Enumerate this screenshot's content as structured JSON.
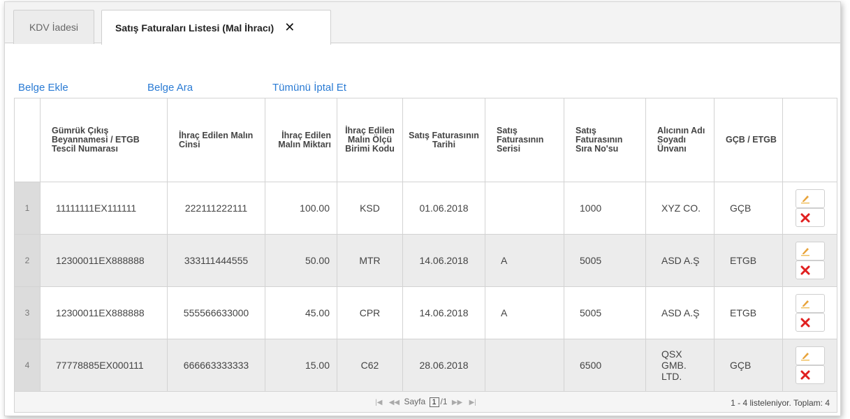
{
  "tabs": [
    {
      "label": "KDV İadesi"
    },
    {
      "label": "Satış Faturaları Listesi (Mal İhracı)",
      "close": "✕"
    }
  ],
  "actions": {
    "add": "Belge Ekle",
    "search": "Belge Ara",
    "cancel_all": "Tümünü İptal Et"
  },
  "table": {
    "headers": [
      "Gümrük Çıkış Beyannamesi / ETGB Tescil Numarası",
      "İhraç Edilen Malın Cinsi",
      "İhraç Edilen Malın Miktarı",
      "İhraç Edilen Malın Ölçü Birimi Kodu",
      "Satış Faturasının Tarihi",
      "Satış Faturasının Serisi",
      "Satış Faturasının Sıra No'su",
      "Alıcının Adı Soyadı Ünvanı",
      "GÇB / ETGB"
    ],
    "rows": [
      {
        "n": "1",
        "gcb": "11111111EX111111",
        "cins": "222111222111",
        "miktar": "100.00",
        "birim": "KSD",
        "tarih": "01.06.2018",
        "seri": "",
        "sira": "1000",
        "alici": "XYZ CO.",
        "tip": "GÇB"
      },
      {
        "n": "2",
        "gcb": "12300011EX888888",
        "cins": "333111444555",
        "miktar": "50.00",
        "birim": "MTR",
        "tarih": "14.06.2018",
        "seri": "A",
        "sira": "5005",
        "alici": "ASD A.Ş",
        "tip": "ETGB"
      },
      {
        "n": "3",
        "gcb": "12300011EX888888",
        "cins": "555566633000",
        "miktar": "45.00",
        "birim": "CPR",
        "tarih": "14.06.2018",
        "seri": "A",
        "sira": "5005",
        "alici": "ASD A.Ş",
        "tip": "ETGB"
      },
      {
        "n": "4",
        "gcb": "77778885EX000111",
        "cins": "666663333333",
        "miktar": "15.00",
        "birim": "C62",
        "tarih": "28.06.2018",
        "seri": "",
        "sira": "6500",
        "alici": "QSX GMB. LTD.",
        "tip": "GÇB"
      }
    ]
  },
  "pager": {
    "first": "|◀",
    "prev": "◀◀",
    "label": "Sayfa",
    "page": "1",
    "total": "/1",
    "next": "▶▶",
    "last": "▶|",
    "count": "1 - 4 listeleniyor. Toplam: 4"
  },
  "colors": {
    "link": "#2a7bd4",
    "delete": "#e02020",
    "edit": "#e8a33a"
  }
}
